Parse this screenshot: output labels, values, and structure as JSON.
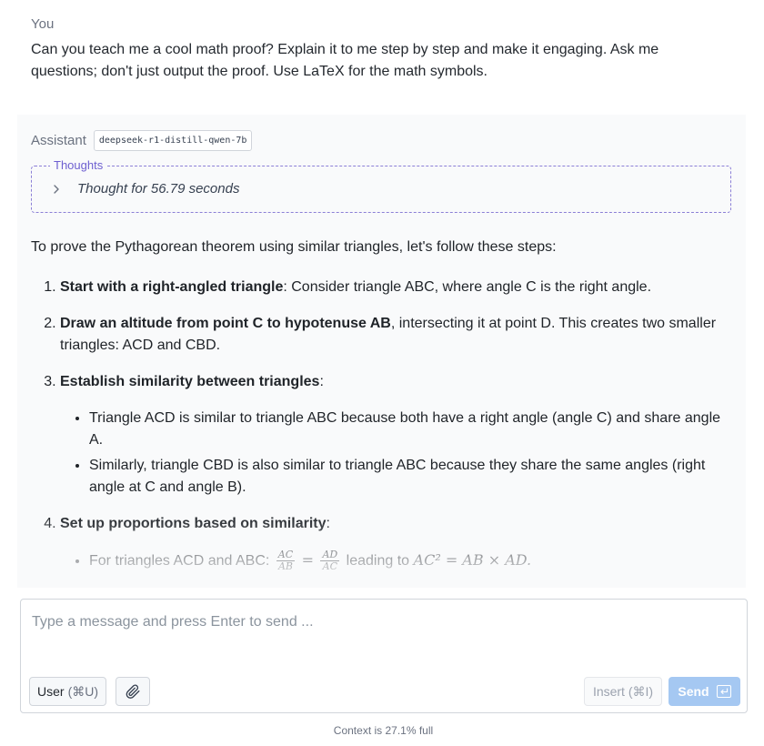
{
  "user": {
    "role": "You",
    "message": "Can you teach me a cool math proof? Explain it to me step by step and make it engaging. Ask me questions; don't just output the proof. Use LaTeX for the math symbols."
  },
  "assistant": {
    "role": "Assistant",
    "model": "deepseek-r1-distill-qwen-7b",
    "thoughts": {
      "legend": "Thoughts",
      "summary": "Thought for 56.79 seconds"
    },
    "intro": "To prove the Pythagorean theorem using similar triangles, let's follow these steps:",
    "steps": [
      {
        "bold": "Start with a right-angled triangle",
        "rest": ": Consider triangle ABC, where angle C is the right angle."
      },
      {
        "bold": "Draw an altitude from point C to hypotenuse AB",
        "rest": ", intersecting it at point D. This creates two smaller triangles: ACD and CBD."
      },
      {
        "bold": "Establish similarity between triangles",
        "rest": ":"
      },
      {
        "bold": "Set up proportions based on similarity",
        "rest": ":"
      }
    ],
    "step3_bullets": [
      "Triangle ACD is similar to triangle ABC because both have a right angle (angle C) and share angle A.",
      "Similarly, triangle CBD is also similar to triangle ABC because they share the same angles (right angle at C and angle B)."
    ],
    "step4_bullet": {
      "prefix": "For triangles ACD and ABC: ",
      "frac1_num": "AC",
      "frac1_den": "AB",
      "eq": "=",
      "frac2_num": "AD",
      "frac2_den": "AC",
      "mid": " leading to ",
      "formula": "AC² = AB × AD."
    }
  },
  "composer": {
    "placeholder": "Type a message and press Enter to send ...",
    "user_button": "User",
    "user_shortcut": "(⌘U)",
    "insert_button": "Insert (⌘I)",
    "send_button": "Send"
  },
  "context_status": "Context is 27.1% full"
}
